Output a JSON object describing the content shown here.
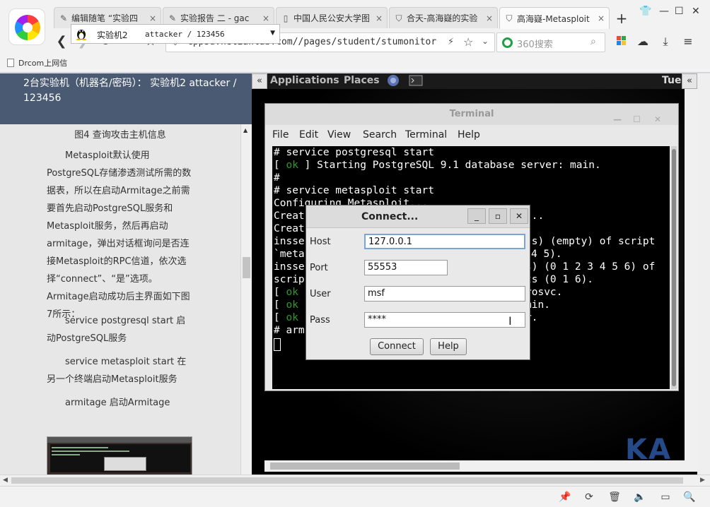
{
  "browser": {
    "tabs": [
      {
        "icon": "pen-icon",
        "label": "编辑随笔 “实验四",
        "close": "×"
      },
      {
        "icon": "pen-icon",
        "label": "实验报告 二 - gac",
        "close": "×"
      },
      {
        "icon": "page-icon",
        "label": "中国人民公安大学图",
        "close": "×"
      },
      {
        "icon": "shield-icon",
        "label": "合天-高海嶷的实验",
        "close": "×"
      },
      {
        "icon": "shield-icon",
        "label": "高海嶷-Metasploit",
        "close": "×"
      }
    ],
    "active_tab_index": 4,
    "url": "cppsu.hetianlab.com//pages/student/stumonitor",
    "search_placeholder": "360搜索",
    "bookmark": "Drcom上网信"
  },
  "left_panel": {
    "header_text": "2台实验机（机器名/密码）：  实验机2    attacker / 123456",
    "vm_select": {
      "name": "实验机2",
      "credentials": "attacker / 123456"
    },
    "figure_caption": "图4 查询攻击主机信息",
    "paragraph": "Metasploit默认使用PostgreSQL存储渗透测试所需的数据表，所以在启动Armitage之前需要首先启动PostgreSQL服务和Metasploit服务，然后再启动armitage，弹出对话框询问是否连接Metasploit的RPC信道，依次选择“connect”、“是”选项。Armitage启动成功后主界面如下图7所示：",
    "commands": [
      "service postgresql start 启动PostgreSQL服务",
      "service metasploit start 在另一个终端启动Metasploit服务",
      "armitage 启动Armitage"
    ]
  },
  "remote": {
    "top_bar": {
      "applications": "Applications",
      "places": "Places",
      "clock": "Tue"
    },
    "kali_logo": "KA",
    "terminal": {
      "title": "Terminal",
      "menu": [
        "File",
        "Edit",
        "View",
        "Search",
        "Terminal",
        "Help"
      ],
      "lines": {
        "l0": "# service postgresql start",
        "l1_ok": "ok",
        "l1_rest": " ] Starting PostgreSQL 9.1 database server: main.",
        "l1_open": "[ ",
        "l2": "#",
        "l3": "# service metasploit start",
        "l4": "Configuring Metasploit...",
        "l5a": "Creat",
        "l5b": "...",
        "l6": "Creat",
        "l7a": "insse",
        "l7b": "(s) (empty) of script",
        "l8a": "`meta",
        "l8b": "4 5).",
        "l9a": "insse",
        "l9b": "s) (0 1 2 3 4 5 6) of",
        "l10a": "scrip",
        "l10b": "ts (0 1 6).",
        "l11_ok": "ok",
        "l11b": "rosvc.",
        "l12_ok": "ok",
        "l12b": "min.",
        "l13_ok": "ok",
        "l13b": "r.",
        "l14": "# arm"
      }
    },
    "connect_dialog": {
      "title": "Connect...",
      "host_label": "Host",
      "host_value": "127.0.0.1",
      "port_label": "Port",
      "port_value": "55553",
      "user_label": "User",
      "user_value": "msf",
      "pass_label": "Pass",
      "pass_value": "****",
      "connect_button": "Connect",
      "help_button": "Help"
    }
  },
  "colors": {
    "header_bg": "#4a5a72",
    "terminal_ok": "#2e9a2e",
    "kali_blue": "#254a8a"
  }
}
